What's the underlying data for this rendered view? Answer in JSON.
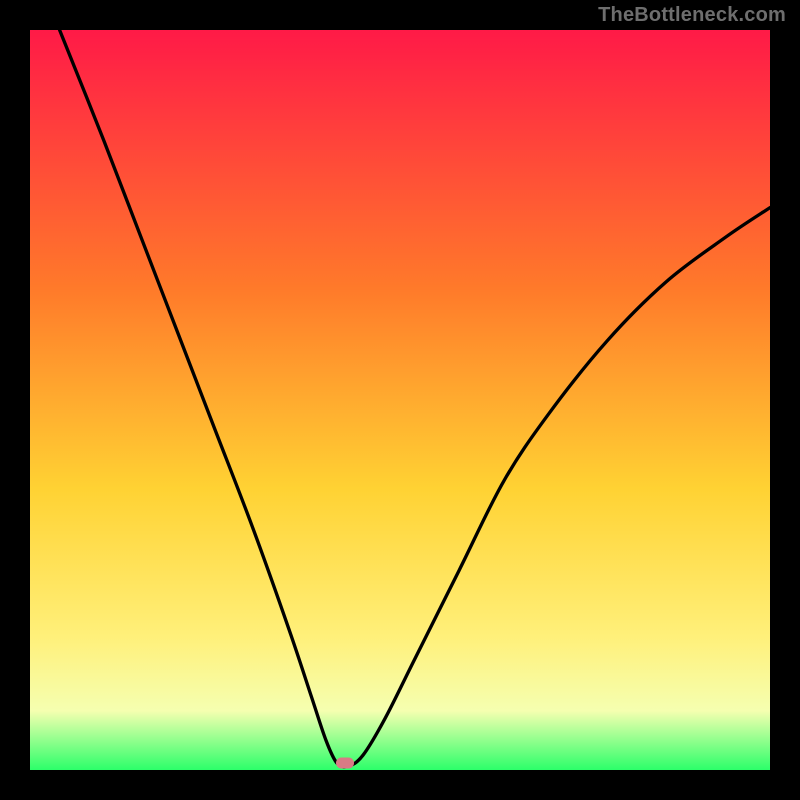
{
  "watermark": "TheBottleneck.com",
  "colors": {
    "frame": "#000000",
    "gradient_top": "#ff1a47",
    "gradient_mid1": "#ff7a2a",
    "gradient_mid2": "#ffd233",
    "gradient_mid3": "#fff07a",
    "gradient_mid4": "#f5ffb0",
    "gradient_bottom": "#2cff6a",
    "curve": "#000000",
    "marker": "#d87a85"
  },
  "chart_data": {
    "type": "line",
    "title": "",
    "xlabel": "",
    "ylabel": "",
    "xlim": [
      0,
      100
    ],
    "ylim": [
      0,
      100
    ],
    "series": [
      {
        "name": "bottleneck-curve",
        "x": [
          4,
          10,
          15,
          20,
          25,
          30,
          35,
          38,
          40,
          41.5,
          43,
          45,
          48,
          52,
          58,
          64,
          70,
          78,
          86,
          94,
          100
        ],
        "values": [
          100,
          85,
          72,
          59,
          46,
          33,
          19,
          10,
          4,
          0.9,
          0.5,
          2,
          7,
          15,
          27,
          39,
          48,
          58,
          66,
          72,
          76
        ]
      }
    ],
    "annotations": [
      {
        "name": "min-marker",
        "shape": "pill",
        "x": 42.5,
        "y": 0.9
      }
    ],
    "gradient_stops": [
      {
        "offset": 0.0,
        "color": "#ff1a47"
      },
      {
        "offset": 0.35,
        "color": "#ff7a2a"
      },
      {
        "offset": 0.62,
        "color": "#ffd233"
      },
      {
        "offset": 0.82,
        "color": "#fff07a"
      },
      {
        "offset": 0.92,
        "color": "#f5ffb0"
      },
      {
        "offset": 1.0,
        "color": "#2cff6a"
      }
    ]
  }
}
